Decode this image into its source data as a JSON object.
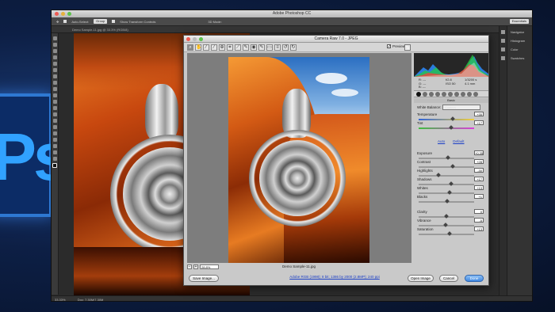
{
  "app": {
    "title": "Adobe Photoshop CC",
    "workspace": "Essentials"
  },
  "options_bar": {
    "auto_select": "Auto-Select:",
    "layer_select": "Group",
    "show_transform": "Show Transform Controls",
    "mode_3d": "3D Mode:"
  },
  "doc_tab": "Demo Sample-11.jpg @ 33.3% (RGB/8)",
  "status_bar": {
    "zoom": "33.33%",
    "doc": "Doc: 7.30M/7.30M"
  },
  "panels": [
    {
      "icon": "navigator-icon",
      "label": "Navigator"
    },
    {
      "icon": "histogram-icon",
      "label": "Histogram"
    },
    {
      "icon": "color-icon",
      "label": "Color"
    },
    {
      "icon": "swatches-icon",
      "label": "Swatches"
    }
  ],
  "acr": {
    "title": "Camera Raw 7.0  -  JPEG",
    "preview_label": "Preview",
    "preview_checked": true,
    "zoom": "28.8%",
    "filename": "Demo Sample-11.jpg",
    "readout": {
      "r": "R:  ---",
      "g": "G:  ---",
      "b": "B:  ---",
      "fstop": "f/2.8",
      "shutter": "1/3200 s",
      "iso": "ISO 50",
      "focal": "4.1 mm"
    },
    "panel_name": "Basic",
    "white_balance": {
      "label": "White Balance:",
      "value": "Custom"
    },
    "auto_label": "Auto",
    "default_label": "Default",
    "sliders": [
      {
        "label": "Temperature",
        "value": "+35",
        "pos": 0.62
      },
      {
        "label": "Tint",
        "value": "+17",
        "pos": 0.58
      },
      {
        "label": "Exposure",
        "value": "+0.35",
        "pos": 0.53
      },
      {
        "label": "Contrast",
        "value": "+28",
        "pos": 0.62
      },
      {
        "label": "Highlights",
        "value": "-30",
        "pos": 0.36
      },
      {
        "label": "Shadows",
        "value": "+17",
        "pos": 0.58
      },
      {
        "label": "Whites",
        "value": "+13",
        "pos": 0.56
      },
      {
        "label": "Blacks",
        "value": "+1",
        "pos": 0.51
      },
      {
        "label": "Clarity",
        "value": "0",
        "pos": 0.5
      },
      {
        "label": "Vibrance",
        "value": "-5",
        "pos": 0.48
      },
      {
        "label": "Saturation",
        "value": "+13",
        "pos": 0.56
      }
    ],
    "buttons": {
      "save": "Save Image...",
      "open": "Open Image",
      "cancel": "Cancel",
      "done": "Done"
    },
    "workflow_link": "Adobe RGB (1998); 8 bit; 1386 by 2000 (2.8MP); 240 ppi"
  },
  "colors": {
    "accent": "#3f87e0",
    "ps_blue": "#31a2ff"
  }
}
